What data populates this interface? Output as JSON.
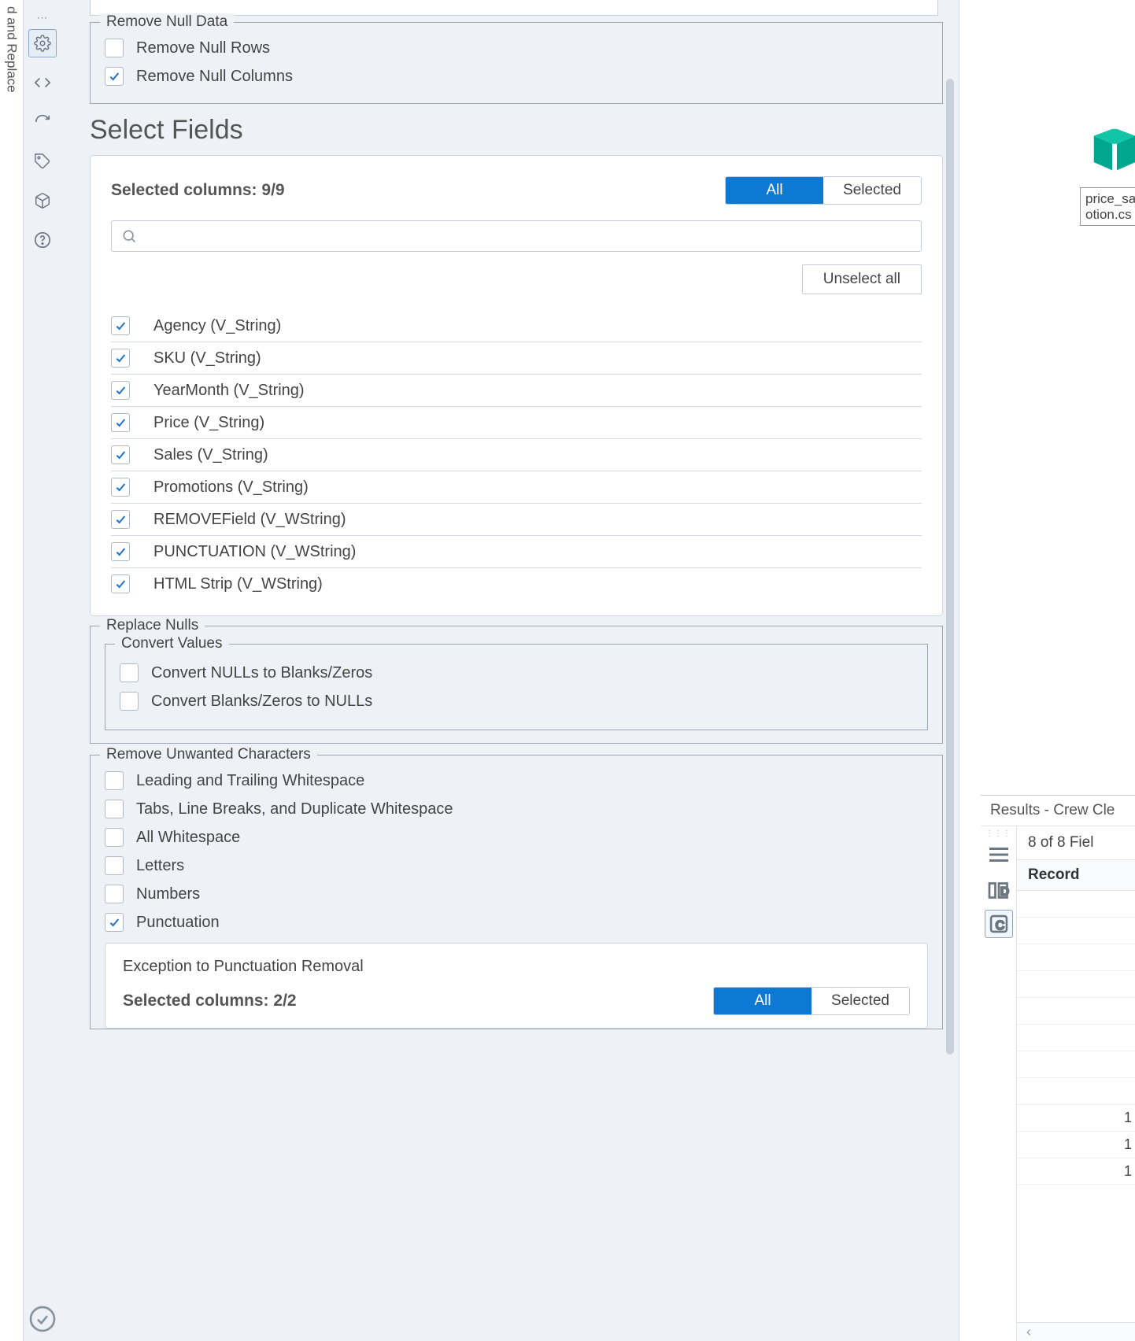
{
  "left_strip_label": "d and Replace",
  "remove_null_data": {
    "legend": "Remove Null Data",
    "rows_label": "Remove Null Rows",
    "cols_label": "Remove Null Columns",
    "rows_checked": false,
    "cols_checked": true
  },
  "select_fields_title": "Select Fields",
  "select_fields": {
    "selected_summary": "Selected columns: 9/9",
    "seg_all": "All",
    "seg_selected": "Selected",
    "search_placeholder": "",
    "unselect_label": "Unselect all",
    "fields": [
      {
        "label": "Agency (V_String)",
        "checked": true
      },
      {
        "label": "SKU (V_String)",
        "checked": true
      },
      {
        "label": "YearMonth (V_String)",
        "checked": true
      },
      {
        "label": "Price (V_String)",
        "checked": true
      },
      {
        "label": "Sales (V_String)",
        "checked": true
      },
      {
        "label": "Promotions (V_String)",
        "checked": true
      },
      {
        "label": "REMOVEField (V_WString)",
        "checked": true
      },
      {
        "label": "PUNCTUATION (V_WString)",
        "checked": true
      },
      {
        "label": "HTML Strip (V_WString)",
        "checked": true
      }
    ]
  },
  "replace_nulls": {
    "legend": "Replace Nulls",
    "convert_legend": "Convert Values",
    "to_blanks_label": "Convert NULLs to Blanks/Zeros",
    "to_nulls_label": "Convert Blanks/Zeros to NULLs"
  },
  "remove_chars": {
    "legend": "Remove Unwanted Characters",
    "items": [
      {
        "label": "Leading and Trailing Whitespace",
        "checked": false
      },
      {
        "label": "Tabs, Line Breaks, and Duplicate Whitespace",
        "checked": false
      },
      {
        "label": "All Whitespace",
        "checked": false
      },
      {
        "label": "Letters",
        "checked": false
      },
      {
        "label": "Numbers",
        "checked": false
      },
      {
        "label": "Punctuation",
        "checked": true
      }
    ],
    "exception_title": "Exception to Punctuation Removal",
    "exception_summary": "Selected columns: 2/2",
    "seg_all": "All",
    "seg_selected": "Selected"
  },
  "canvas": {
    "tool_caption_line1": "price_sa",
    "tool_caption_line2": "otion.cs"
  },
  "results": {
    "title": "Results - Crew Cle",
    "meta": "8 of 8 Fiel",
    "record_header": "Record",
    "rows": [
      "",
      "",
      "",
      "",
      "",
      "",
      "",
      "",
      "1",
      "1",
      "1"
    ]
  }
}
